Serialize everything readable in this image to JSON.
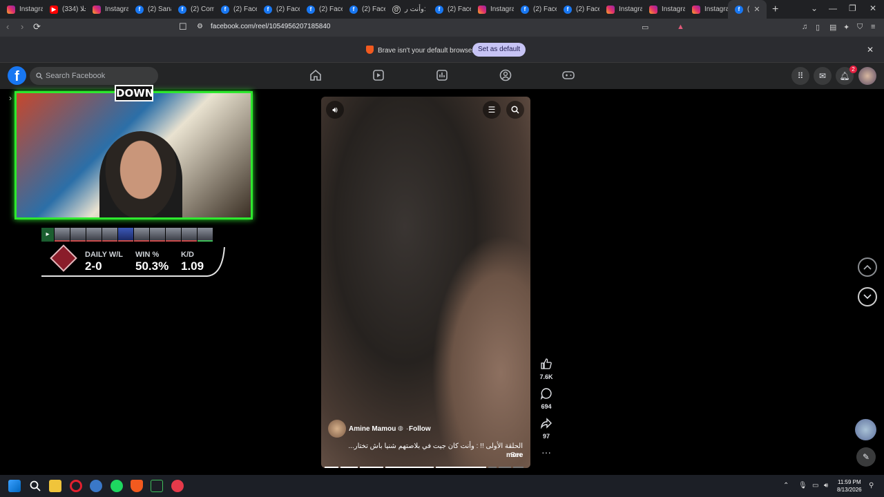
{
  "browser": {
    "tabs": [
      {
        "label": "Instagra",
        "favicon": "instagram-icon"
      },
      {
        "label": "(334) حلا",
        "favicon": "youtube-icon"
      },
      {
        "label": "Instagra",
        "favicon": "instagram-icon"
      },
      {
        "label": "(2) Sana",
        "favicon": "facebook-icon"
      },
      {
        "label": "(2) Com",
        "favicon": "facebook-icon"
      },
      {
        "label": "(2) Face",
        "favicon": "facebook-icon"
      },
      {
        "label": "(2) Face",
        "favicon": "facebook-icon"
      },
      {
        "label": "(2) Face",
        "favicon": "facebook-icon"
      },
      {
        "label": "(2) Face",
        "favicon": "facebook-icon"
      },
      {
        "label": "وأنت ر:",
        "favicon": "threads-icon"
      },
      {
        "label": "(2) Face",
        "favicon": "facebook-icon"
      },
      {
        "label": "Instagra",
        "favicon": "instagram-icon"
      },
      {
        "label": "(2) Face",
        "favicon": "facebook-icon"
      },
      {
        "label": "(2) Face",
        "favicon": "facebook-icon"
      },
      {
        "label": "Instagra",
        "favicon": "instagram-icon"
      },
      {
        "label": "Instagra",
        "favicon": "instagram-icon"
      },
      {
        "label": "Instagra",
        "favicon": "instagram-icon"
      },
      {
        "label": "(",
        "favicon": "facebook-icon",
        "active": true
      }
    ],
    "url": "facebook.com/reel/1054956207185840"
  },
  "banner": {
    "text": "Brave isn't your default browser",
    "button": "Set as default"
  },
  "facebook": {
    "logo": "f",
    "search_placeholder": "Search Facebook",
    "notification_count": "2"
  },
  "overlay": {
    "badge": "DOWN",
    "stats": [
      {
        "label": "DAILY W/L",
        "value": "2-0"
      },
      {
        "label": "WIN %",
        "value": "50.3%"
      },
      {
        "label": "K/D",
        "value": "1.09"
      }
    ]
  },
  "reel": {
    "author": "Amine Mamou",
    "follow": "Follow",
    "caption": "الحلقة الأولى !! : وأنت كان جيت في بلاصتهم شنيا باش تختار... See",
    "see_more": "more",
    "likes": "7.6K",
    "comments": "694",
    "shares": "97"
  },
  "taskbar": {
    "time": "11:59 PM",
    "date": "8/13/2026"
  },
  "colors": {
    "fb_blue": "#1877f2",
    "overlay_green": "#2ee82e",
    "banner_button": "#c7c4f5"
  }
}
